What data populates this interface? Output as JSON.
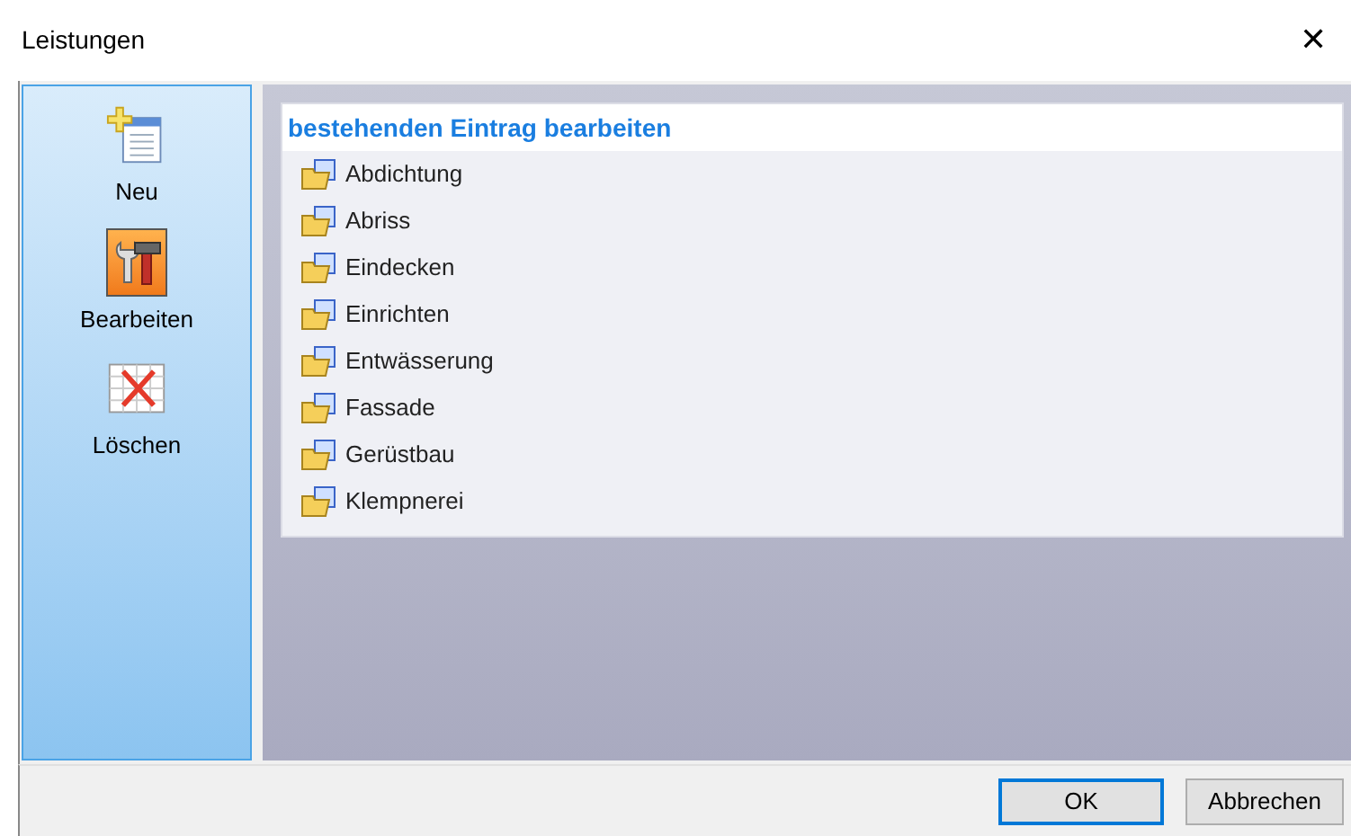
{
  "window": {
    "title": "Leistungen",
    "close": "✕"
  },
  "toolbar": [
    {
      "kind": "new",
      "label": "Neu",
      "selected": false
    },
    {
      "kind": "edit",
      "label": "Bearbeiten",
      "selected": true
    },
    {
      "kind": "delete",
      "label": "Löschen",
      "selected": false
    }
  ],
  "list": {
    "heading": "bestehenden Eintrag bearbeiten",
    "items": [
      "Abdichtung",
      "Abriss",
      "Eindecken",
      "Einrichten",
      "Entwässerung",
      "Fassade",
      "Gerüstbau",
      "Klempnerei"
    ]
  },
  "buttons": [
    {
      "label": "OK",
      "default": true
    },
    {
      "label": "Abbrechen",
      "default": false
    }
  ]
}
